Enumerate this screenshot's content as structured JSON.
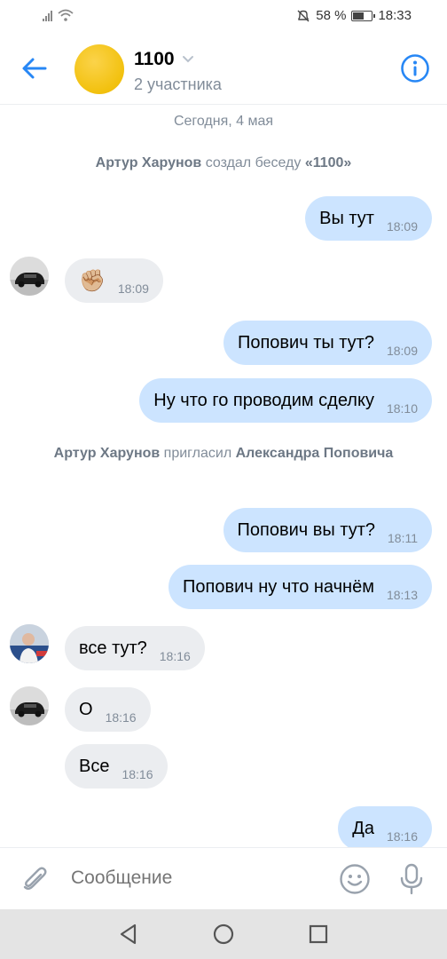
{
  "status_bar": {
    "battery_percent": "58 %",
    "battery_level": 0.58,
    "time": "18:33",
    "icons": [
      "signal-icon",
      "wifi-icon",
      "mute-icon",
      "battery-icon"
    ]
  },
  "header": {
    "title": "1100",
    "subtitle": "2 участника",
    "avatar_color": "#f2c10e",
    "icons": [
      "back-arrow-icon",
      "chevron-down-icon",
      "info-icon"
    ]
  },
  "chat": {
    "date": "Сегодня, 4 мая",
    "created": {
      "name": "Артур Харунов",
      "action": "создал беседу",
      "chat_name": "«1100»"
    },
    "invited": {
      "name": "Артур Харунов",
      "action": "пригласил",
      "target": "Александра Поповича"
    },
    "messages": [
      {
        "dir": "out",
        "text": "Вы тут",
        "time": "18:09"
      },
      {
        "dir": "in",
        "text": "✊🏼",
        "time": "18:09",
        "avatar": "car"
      },
      {
        "dir": "out",
        "text": "Попович ты тут?",
        "time": "18:09"
      },
      {
        "dir": "out",
        "text": "Ну что го проводим сделку",
        "time": "18:10"
      },
      {
        "dir": "out",
        "text": "Попович вы тут?",
        "time": "18:11"
      },
      {
        "dir": "out",
        "text": "Попович ну что начнём",
        "time": "18:13"
      },
      {
        "dir": "in",
        "text": "все тут?",
        "time": "18:16",
        "avatar": "photo"
      },
      {
        "dir": "in",
        "text": "О",
        "time": "18:16",
        "avatar": "car"
      },
      {
        "dir": "in",
        "text": "Все",
        "time": "18:16"
      },
      {
        "dir": "out",
        "text": "Да",
        "time": "18:16"
      }
    ]
  },
  "composer": {
    "placeholder": "Сообщение",
    "icons": [
      "paperclip-icon",
      "smile-icon",
      "microphone-icon"
    ]
  },
  "colors": {
    "accent": "#2787f5",
    "outgoing_bubble": "#cce4ff",
    "incoming_bubble": "#ebedf0",
    "secondary_text": "#818c99"
  },
  "nav_bar": {
    "icons": [
      "nav-back-icon",
      "nav-home-icon",
      "nav-recents-icon"
    ]
  }
}
